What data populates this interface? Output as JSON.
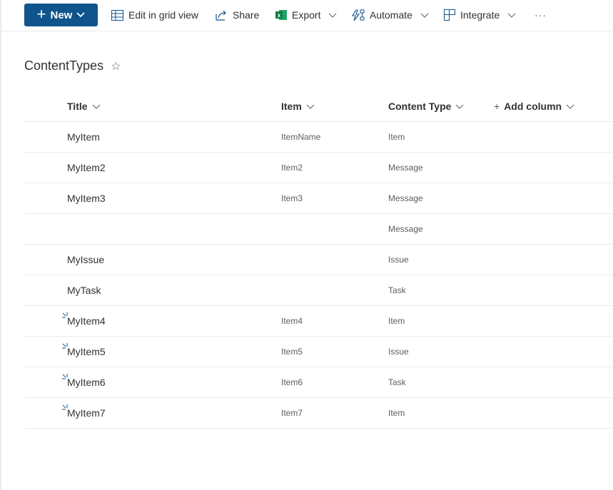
{
  "toolbar": {
    "new_label": "New",
    "edit_grid_label": "Edit in grid view",
    "share_label": "Share",
    "export_label": "Export",
    "automate_label": "Automate",
    "integrate_label": "Integrate",
    "more_label": "···",
    "accent_color": "#0f548c"
  },
  "list": {
    "title": "ContentTypes",
    "favorite_icon": "star-outline-icon"
  },
  "columns": [
    {
      "label": "Title"
    },
    {
      "label": "Item"
    },
    {
      "label": "Content Type"
    },
    {
      "label": "Add column",
      "prefix": "+"
    }
  ],
  "rows": [
    {
      "title": "MyItem",
      "item": "ItemName",
      "content_type": "Item",
      "new": false
    },
    {
      "title": "MyItem2",
      "item": "Item2",
      "content_type": "Message",
      "new": false
    },
    {
      "title": "MyItem3",
      "item": "Item3",
      "content_type": "Message",
      "new": false
    },
    {
      "title": "",
      "item": "",
      "content_type": "Message",
      "new": false
    },
    {
      "title": "MyIssue",
      "item": "",
      "content_type": "Issue",
      "new": false
    },
    {
      "title": "MyTask",
      "item": "",
      "content_type": "Task",
      "new": false
    },
    {
      "title": "MyItem4",
      "item": "Item4",
      "content_type": "Item",
      "new": true
    },
    {
      "title": "MyItem5",
      "item": "Item5",
      "content_type": "Issue",
      "new": true
    },
    {
      "title": "MyItem6",
      "item": "Item6",
      "content_type": "Task",
      "new": true
    },
    {
      "title": "MyItem7",
      "item": "Item7",
      "content_type": "Item",
      "new": true
    }
  ]
}
